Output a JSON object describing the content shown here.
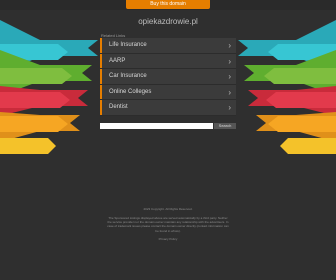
{
  "banner": {
    "buy_label": "Buy this domain"
  },
  "domain": "opiekazdrowie.pl",
  "related": {
    "heading": "Related Links",
    "items": [
      {
        "label": "Life Insurance"
      },
      {
        "label": "AARP"
      },
      {
        "label": "Car Insurance"
      },
      {
        "label": "Online Colleges"
      },
      {
        "label": "Dentist"
      }
    ]
  },
  "search": {
    "value": "",
    "button_label": "Search"
  },
  "footer": {
    "copyright": "2023 Copyright. All Rights Reserved.",
    "disclaimer": "The Sponsored Listings displayed above are served automatically by a third party. Neither the service provider nor the domain owner maintain any relationship with the advertisers. In case of trademark issues please contact the domain owner directly (contact information can be found in whois).",
    "privacy_label": "Privacy Policy"
  },
  "colors": {
    "accent": "#e67e00",
    "background": "#2f2f2f",
    "arrow_colors": [
      "#37c6d3",
      "#2fb6c9",
      "#7fbe3f",
      "#5fae2f",
      "#e23a4c",
      "#c92b3b",
      "#f6a623",
      "#f4c22a"
    ]
  }
}
